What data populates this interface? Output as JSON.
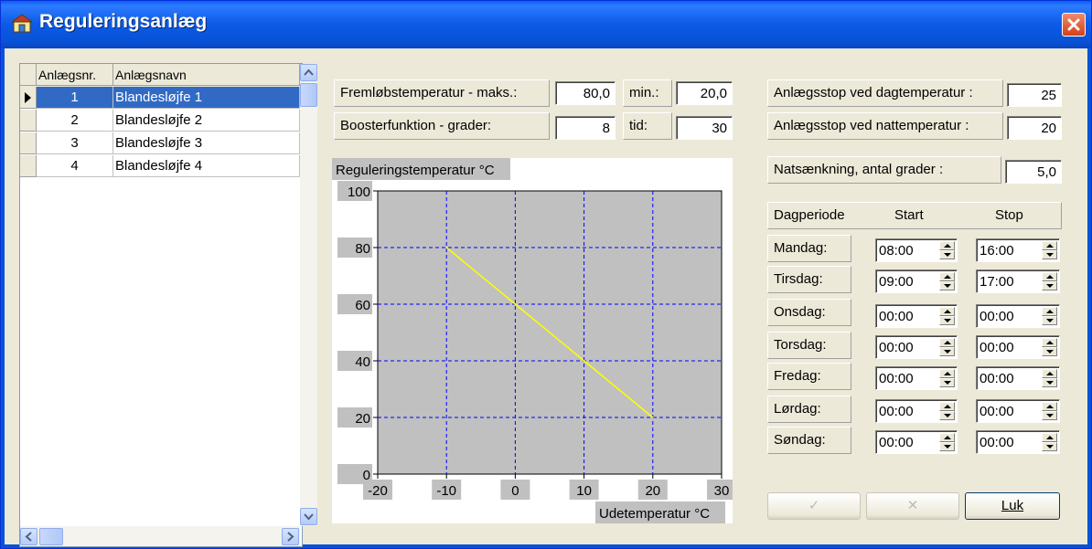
{
  "window": {
    "title": "Reguleringsanlæg"
  },
  "grid": {
    "columns": [
      "Anlægsnr.",
      "Anlægsnavn"
    ],
    "rows": [
      {
        "nr": "1",
        "name": "Blandesløjfe 1",
        "selected": true
      },
      {
        "nr": "2",
        "name": "Blandesløjfe 2",
        "selected": false
      },
      {
        "nr": "3",
        "name": "Blandesløjfe 3",
        "selected": false
      },
      {
        "nr": "4",
        "name": "Blandesløjfe 4",
        "selected": false
      }
    ]
  },
  "flow": {
    "label": "Fremløbstemperatur  -  maks.:",
    "max_value": "80,0",
    "min_label": "min.:",
    "min_value": "20,0"
  },
  "booster": {
    "label": "Boosterfunktion    -    grader:",
    "degrees_value": "8",
    "time_label": "tid:",
    "time_value": "30"
  },
  "stop": {
    "day_label": "Anlægsstop ved dagtemperatur :",
    "day_value": "25",
    "night_label": "Anlægsstop ved nattemperatur :",
    "night_value": "20",
    "nightsetback_label": "Natsænkning, antal grader :",
    "nightsetback_value": "5,0"
  },
  "schedule": {
    "header_label": "Dagperiode",
    "start_label": "Start",
    "stop_label": "Stop",
    "days": [
      {
        "day": "Mandag:",
        "start": "08:00",
        "stop": "16:00"
      },
      {
        "day": "Tirsdag:",
        "start": "09:00",
        "stop": "17:00"
      },
      {
        "day": "Onsdag:",
        "start": "00:00",
        "stop": "00:00"
      },
      {
        "day": "Torsdag:",
        "start": "00:00",
        "stop": "00:00"
      },
      {
        "day": "Fredag:",
        "start": "00:00",
        "stop": "00:00"
      },
      {
        "day": "Lørdag:",
        "start": "00:00",
        "stop": "00:00"
      },
      {
        "day": "Søndag:",
        "start": "00:00",
        "stop": "00:00"
      }
    ]
  },
  "buttons": {
    "ok": "✓",
    "cancel": "✕",
    "close": "Luk"
  },
  "chart_data": {
    "type": "line",
    "ylabel": "Reguleringstemperatur °C",
    "xlabel": "Udetemperatur °C",
    "xlim": [
      -20,
      30
    ],
    "ylim": [
      0,
      100
    ],
    "xticks": [
      -20,
      -10,
      0,
      10,
      20,
      30
    ],
    "yticks": [
      0,
      20,
      40,
      60,
      80,
      100
    ],
    "grid": true,
    "series": [
      {
        "x": [
          -10,
          0,
          10,
          20
        ],
        "y": [
          80,
          60,
          40,
          20
        ],
        "color": "#ffff00"
      }
    ],
    "colors": {
      "plot_bg": "#c0c0c0",
      "grid": "#0000ff",
      "line": "#ffff00"
    }
  }
}
